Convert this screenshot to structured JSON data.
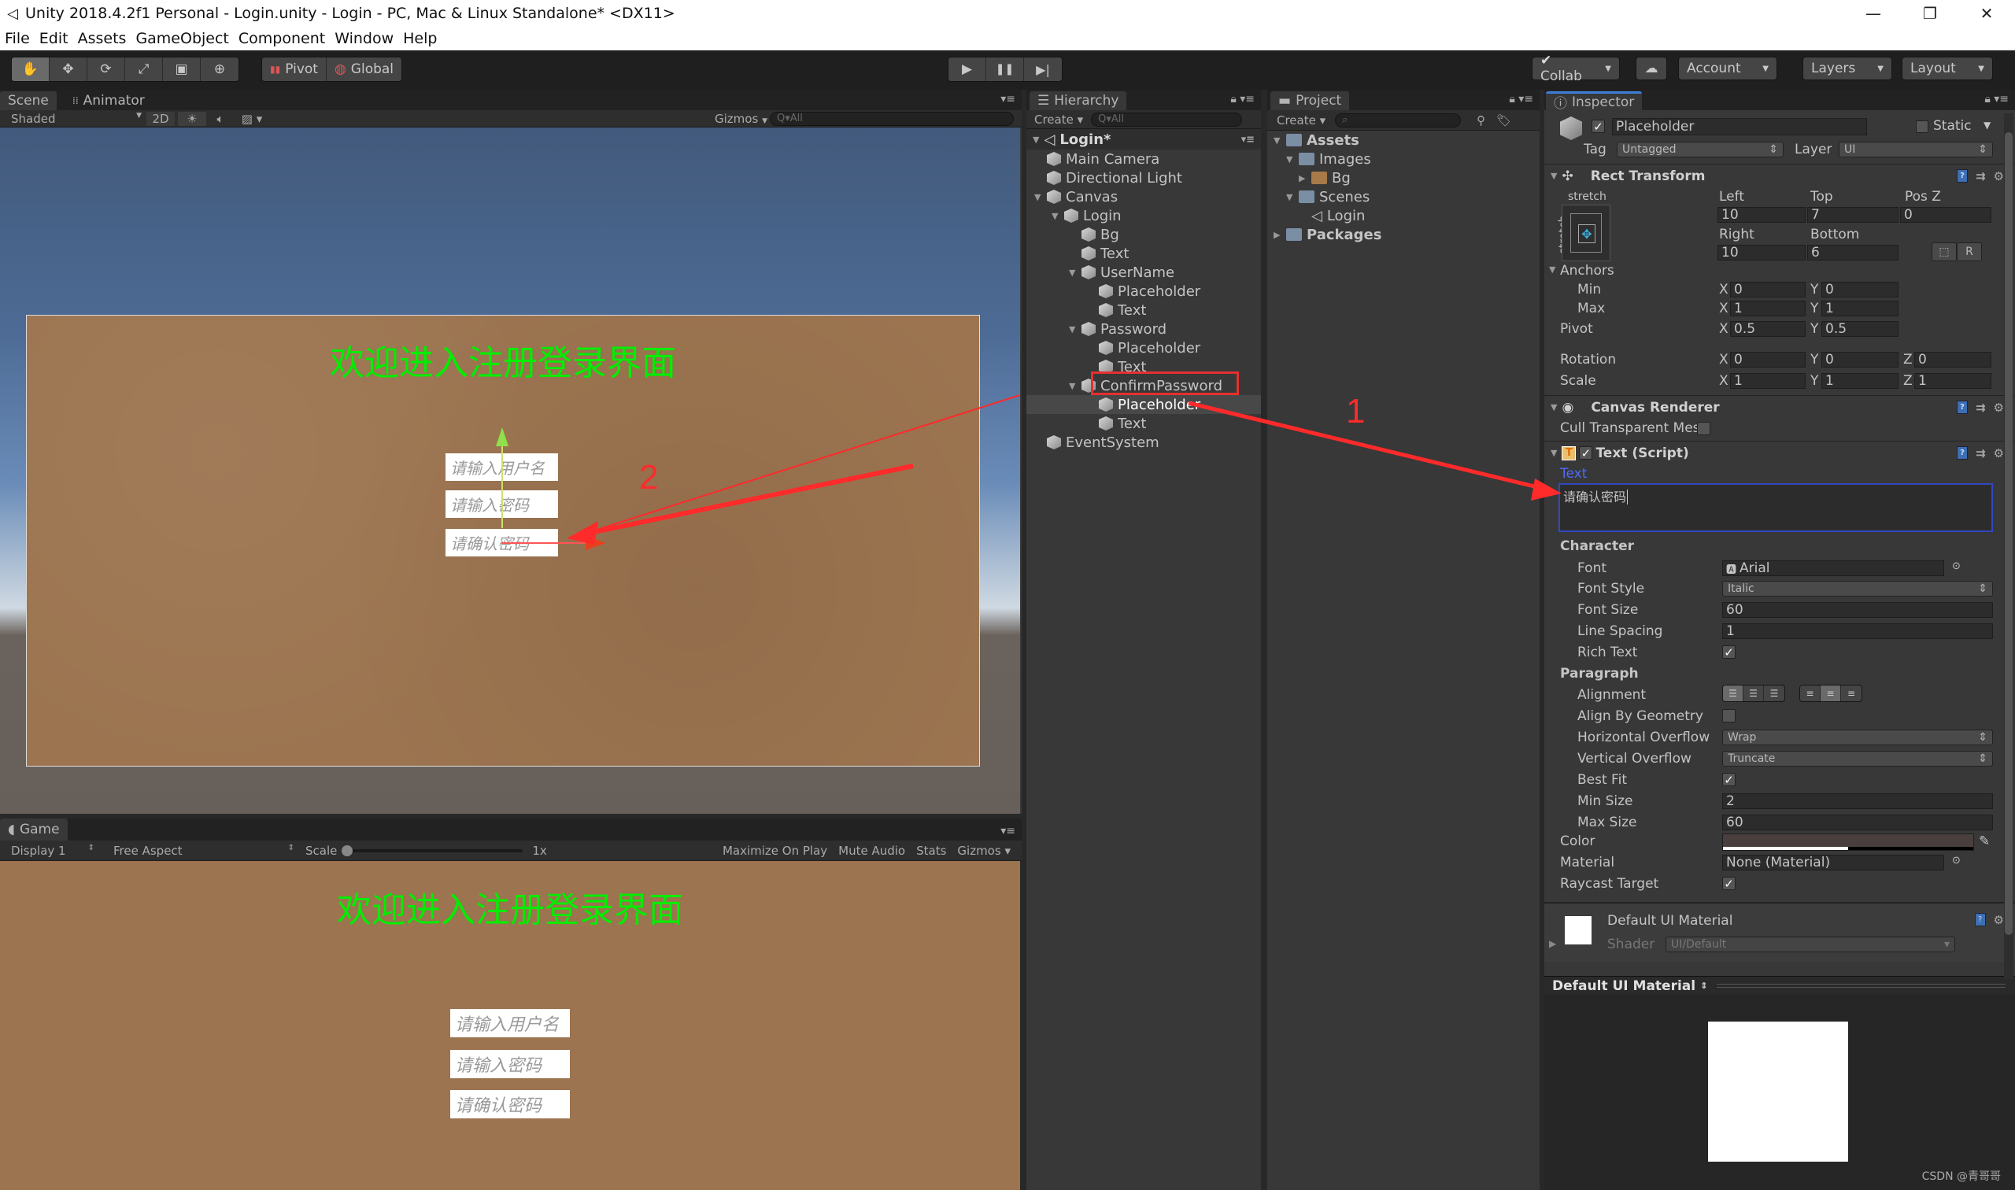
{
  "window": {
    "title": "Unity 2018.4.2f1 Personal - Login.unity - Login - PC, Mac & Linux Standalone* <DX11>",
    "controls": [
      "minimize",
      "restore",
      "close"
    ]
  },
  "menu": [
    "File",
    "Edit",
    "Assets",
    "GameObject",
    "Component",
    "Window",
    "Help"
  ],
  "toolbar": {
    "tools": [
      "hand-tool",
      "move-tool",
      "rotate-tool",
      "scale-tool",
      "rect-tool",
      "transform-tool"
    ],
    "pivot": "Pivot",
    "global": "Global",
    "play": "▶",
    "pause": "❚❚",
    "step": "▶|",
    "collab": "Collab",
    "account": "Account",
    "layers": "Layers",
    "layout": "Layout"
  },
  "scene": {
    "tabs": [
      "Scene",
      "Animator"
    ],
    "shading": "Shaded",
    "mode2d": "2D",
    "gizmos": "Gizmos",
    "search_placeholder": "Q▾All",
    "canvas_title": "欢迎进入注册登录界面",
    "inputs": [
      "请输入用户名",
      "请输入密码",
      "请确认密码"
    ]
  },
  "game": {
    "tab": "Game",
    "display": "Display 1",
    "aspect": "Free Aspect",
    "scale_label": "Scale",
    "scale_value": "1x",
    "maximize": "Maximize On Play",
    "mute": "Mute Audio",
    "stats": "Stats",
    "gizmos": "Gizmos",
    "canvas_title": "欢迎进入注册登录界面",
    "inputs": [
      "请输入用户名",
      "请输入密码",
      "请确认密码"
    ]
  },
  "hierarchy": {
    "tab": "Hierarchy",
    "create": "Create",
    "search_placeholder": "Q▾All",
    "scene_name": "Login*",
    "items": [
      {
        "label": "Main Camera",
        "depth": 1,
        "expanded": null
      },
      {
        "label": "Directional Light",
        "depth": 1,
        "expanded": null
      },
      {
        "label": "Canvas",
        "depth": 1,
        "expanded": true
      },
      {
        "label": "Login",
        "depth": 2,
        "expanded": true
      },
      {
        "label": "Bg",
        "depth": 3,
        "expanded": null
      },
      {
        "label": "Text",
        "depth": 3,
        "expanded": null
      },
      {
        "label": "UserName",
        "depth": 3,
        "expanded": true
      },
      {
        "label": "Placeholder",
        "depth": 4,
        "expanded": null
      },
      {
        "label": "Text",
        "depth": 4,
        "expanded": null
      },
      {
        "label": "Password",
        "depth": 3,
        "expanded": true
      },
      {
        "label": "Placeholder",
        "depth": 4,
        "expanded": null
      },
      {
        "label": "Text",
        "depth": 4,
        "expanded": null
      },
      {
        "label": "ConfirmPassword",
        "depth": 3,
        "expanded": true,
        "highlighted": true
      },
      {
        "label": "Placeholder",
        "depth": 4,
        "expanded": null,
        "selected": true
      },
      {
        "label": "Text",
        "depth": 4,
        "expanded": null
      },
      {
        "label": "EventSystem",
        "depth": 1,
        "expanded": null
      }
    ]
  },
  "project": {
    "tab": "Project",
    "create": "Create",
    "items": [
      {
        "label": "Assets",
        "depth": 0,
        "type": "folder",
        "bold": true,
        "expanded": true
      },
      {
        "label": "Images",
        "depth": 1,
        "type": "folder",
        "expanded": true
      },
      {
        "label": "Bg",
        "depth": 2,
        "type": "texture",
        "expanded": false
      },
      {
        "label": "Scenes",
        "depth": 1,
        "type": "folder",
        "expanded": true
      },
      {
        "label": "Login",
        "depth": 2,
        "type": "scene"
      },
      {
        "label": "Packages",
        "depth": 0,
        "type": "folder",
        "bold": true,
        "expanded": false
      }
    ]
  },
  "inspector": {
    "tab": "Inspector",
    "object_name": "Placeholder",
    "active": true,
    "static_label": "Static",
    "static": false,
    "tag_label": "Tag",
    "tag": "Untagged",
    "layer_label": "Layer",
    "layer": "UI",
    "rect_transform": {
      "title": "Rect Transform",
      "anchor_preset_h": "stretch",
      "anchor_preset_v": "stretch",
      "left_label": "Left",
      "left": "10",
      "top_label": "Top",
      "top": "7",
      "posz_label": "Pos Z",
      "posz": "0",
      "right_label": "Right",
      "right": "10",
      "bottom_label": "Bottom",
      "bottom": "6",
      "r_button": "R",
      "anchors_label": "Anchors",
      "min_label": "Min",
      "min_x": "0",
      "min_y": "0",
      "max_label": "Max",
      "max_x": "1",
      "max_y": "1",
      "pivot_label": "Pivot",
      "pivot_x": "0.5",
      "pivot_y": "0.5",
      "rotation_label": "Rotation",
      "rot_x": "0",
      "rot_y": "0",
      "rot_z": "0",
      "scale_label": "Scale",
      "scale_x": "1",
      "scale_y": "1",
      "scale_z": "1"
    },
    "canvas_renderer": {
      "title": "Canvas Renderer",
      "cull_label": "Cull Transparent Mesh",
      "cull": false
    },
    "text_script": {
      "title": "Text (Script)",
      "enabled": true,
      "text_label": "Text",
      "text_value": "请确认密码",
      "character_label": "Character",
      "font_label": "Font",
      "font": "Arial",
      "font_style_label": "Font Style",
      "font_style": "Italic",
      "font_size_label": "Font Size",
      "font_size": "60",
      "line_spacing_label": "Line Spacing",
      "line_spacing": "1",
      "rich_text_label": "Rich Text",
      "rich_text": true,
      "paragraph_label": "Paragraph",
      "alignment_label": "Alignment",
      "align_by_geometry_label": "Align By Geometry",
      "align_by_geometry": false,
      "h_overflow_label": "Horizontal Overflow",
      "h_overflow": "Wrap",
      "v_overflow_label": "Vertical Overflow",
      "v_overflow": "Truncate",
      "best_fit_label": "Best Fit",
      "best_fit": true,
      "min_size_label": "Min Size",
      "min_size": "2",
      "max_size_label": "Max Size",
      "max_size": "60",
      "color_label": "Color",
      "color": "#4a3f3f",
      "color_alpha": 0.5,
      "material_label": "Material",
      "material": "None (Material)",
      "raycast_label": "Raycast Target",
      "raycast": true
    },
    "material": {
      "name": "Default UI Material",
      "shader_label": "Shader",
      "shader": "UI/Default"
    },
    "preview_label": "Default UI Material"
  },
  "annotations": {
    "label1": "1",
    "label2": "2"
  },
  "watermark": "CSDN @青哥哥",
  "colors": {
    "accent_blue": "#3d7fd8",
    "annotation_red": "#ff2a2a",
    "title_green": "#00ee00",
    "text_label_blue": "#4f6cf0"
  }
}
